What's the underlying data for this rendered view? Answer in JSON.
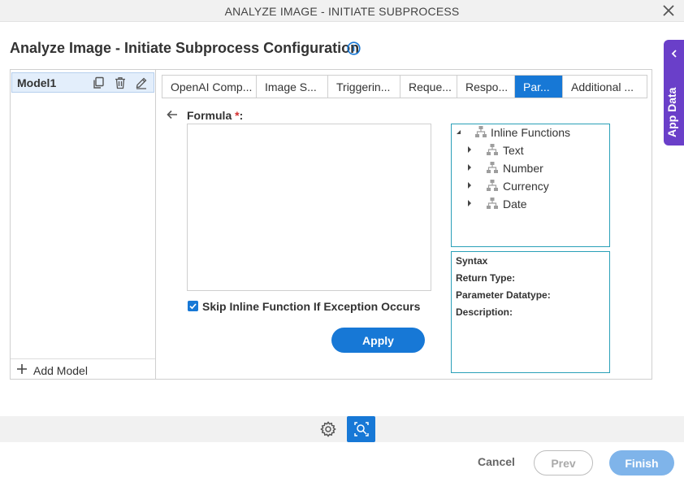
{
  "window": {
    "title": "ANALYZE IMAGE - INITIATE SUBPROCESS"
  },
  "page": {
    "title": "Analyze Image - Initiate Subprocess Configuration"
  },
  "app_data_tab": {
    "label": "App Data"
  },
  "models": {
    "items": [
      {
        "name": "Model1"
      }
    ],
    "add_label": "Add Model"
  },
  "tabs": [
    {
      "label": "OpenAI Comp..."
    },
    {
      "label": "Image S..."
    },
    {
      "label": "Triggerin..."
    },
    {
      "label": "Reque..."
    },
    {
      "label": "Respo..."
    },
    {
      "label": "Par..."
    },
    {
      "label": "Additional ..."
    }
  ],
  "active_tab": "Par...",
  "formula": {
    "label": "Formula",
    "required_marker": "*",
    "suffix": ":",
    "value": "",
    "skip_label": "Skip Inline Function If Exception Occurs",
    "skip_checked": true,
    "apply_label": "Apply"
  },
  "tree": {
    "root": "Inline Functions",
    "children": [
      "Text",
      "Number",
      "Currency",
      "Date"
    ]
  },
  "syntax": {
    "syntax_label": "Syntax",
    "return_type_label": "Return Type:",
    "parameter_datatype_label": "Parameter Datatype:",
    "description_label": "Description:"
  },
  "footer": {
    "cancel_label": "Cancel",
    "prev_label": "Prev",
    "finish_label": "Finish"
  },
  "colors": {
    "accent": "#1778d6",
    "app_data_tab": "#6a3fc9",
    "tree_border": "#2aa0b8",
    "required": "#d32f2f"
  },
  "icons": {
    "close": "close-icon",
    "info": "info-icon",
    "copy": "copy-icon",
    "delete": "trash-icon",
    "edit": "pencil-icon",
    "add": "plus-icon",
    "back": "arrow-left-icon",
    "tree_node": "hierarchy-icon",
    "settings": "gear-icon",
    "analyze": "analyze-image-icon"
  }
}
